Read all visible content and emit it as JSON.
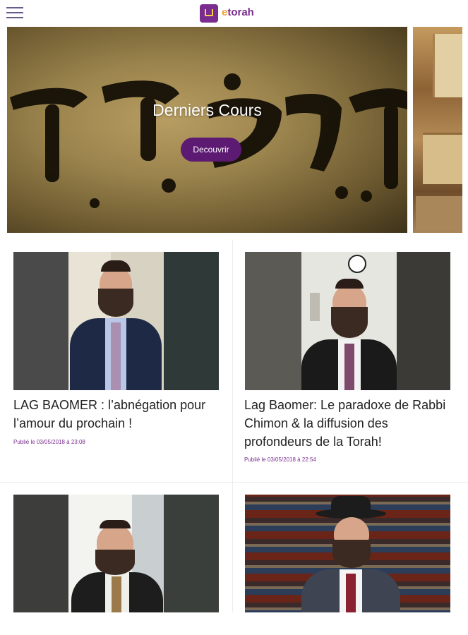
{
  "header": {
    "menu_icon": "hamburger-menu-icon",
    "logo_e": "e",
    "logo_rest": "torah"
  },
  "hero": {
    "title": "Derniers Cours",
    "button_label": "Decouvrir"
  },
  "courses": [
    {
      "title": "LAG BAOMER : l’abnégation pour l’amour du prochain !",
      "date": "Publié le 03/05/2018 à 23:08"
    },
    {
      "title": "Lag Baomer: Le paradoxe de Rabbi Chimon & la diffusion des profondeurs de la Torah!",
      "date": "Publié le 03/05/2018 à 22:54"
    },
    {
      "title": "",
      "date": ""
    },
    {
      "title": "",
      "date": ""
    }
  ],
  "colors": {
    "brand_purple": "#7a2c8f",
    "button_purple": "#5d1a73",
    "logo_orange": "#f2a33a"
  }
}
